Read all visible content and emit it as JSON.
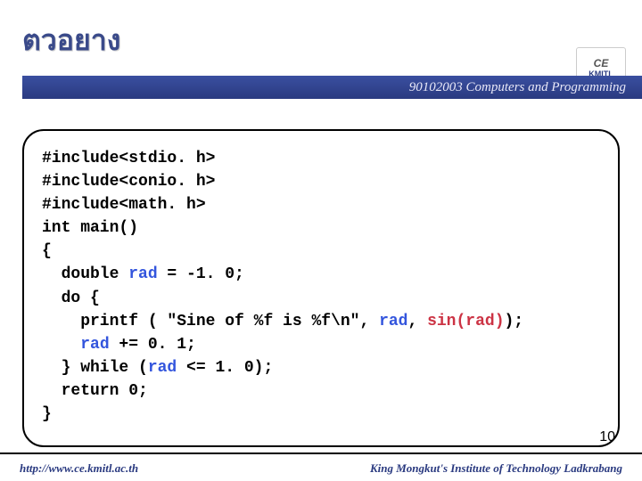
{
  "title": "ตวอยาง",
  "header": {
    "course": "90102003 Computers and Programming",
    "logo_top": "CE",
    "logo_bottom": "KMITL"
  },
  "code": {
    "l1": "#include<stdio. h>",
    "l2": "#include<conio. h>",
    "l3": "#include<math. h>",
    "l4": "int main()",
    "l5": "{",
    "l6a": "  double ",
    "l6b": "rad",
    "l6c": " = -1. 0;",
    "l7": "  do {",
    "l8a": "    printf ( \"Sine of %f is %f\\n\", ",
    "l8b": "rad",
    "l8c": ", ",
    "l8d": "sin(rad)",
    "l8e": ");",
    "l9a": "    ",
    "l9b": "rad",
    "l9c": " += 0. 1;",
    "l10a": "  } while (",
    "l10b": "rad",
    "l10c": " <= 1. 0);",
    "l11": "  return 0;",
    "l12": "}"
  },
  "page_number": "10",
  "footer": {
    "left": "http://www.ce.kmitl.ac.th",
    "right": "King Mongkut's Institute of Technology Ladkrabang"
  }
}
